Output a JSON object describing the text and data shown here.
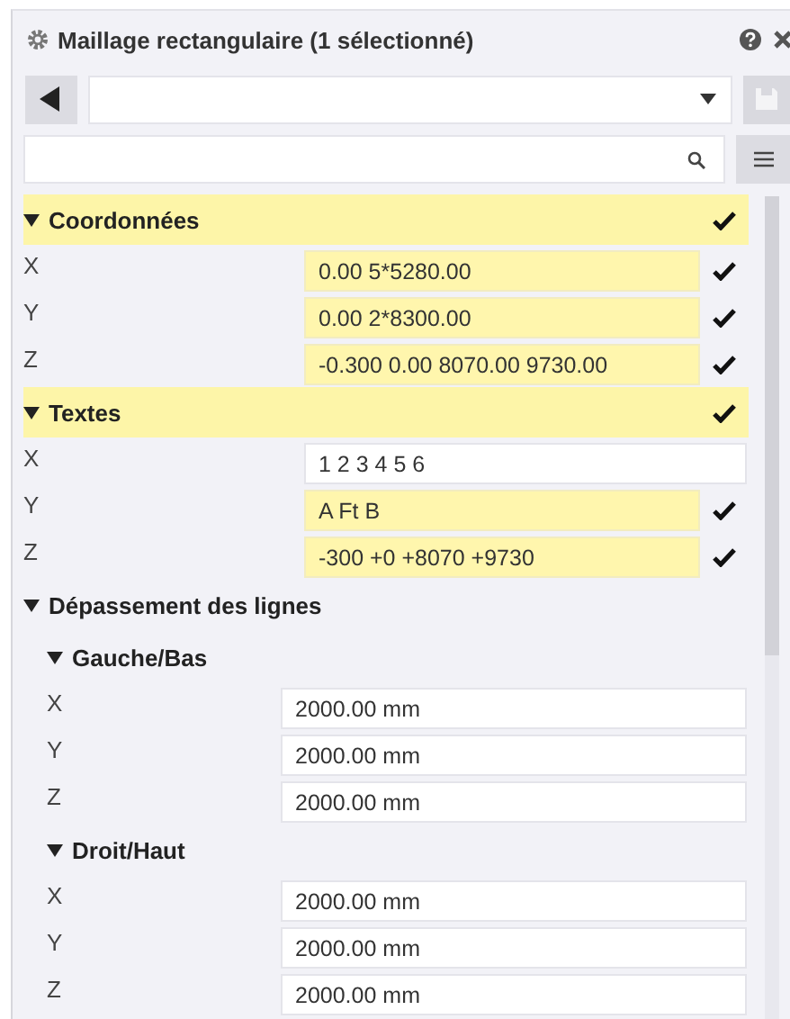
{
  "panel": {
    "title": "Maillage rectangulaire (1 sélectionné)"
  },
  "sections": [
    {
      "label": "Coordonnées",
      "expanded": true,
      "highlighted": true,
      "checked": true,
      "rows": [
        {
          "label": "X",
          "value": "0.00 5*5280.00",
          "highlighted": true,
          "checked": true
        },
        {
          "label": "Y",
          "value": "0.00 2*8300.00",
          "highlighted": true,
          "checked": true
        },
        {
          "label": "Z",
          "value": "-0.300 0.00 8070.00 9730.00",
          "highlighted": true,
          "checked": true
        }
      ]
    },
    {
      "label": "Textes",
      "expanded": true,
      "highlighted": true,
      "checked": true,
      "rows": [
        {
          "label": "X",
          "value": "1 2 3 4 5 6",
          "highlighted": false,
          "checked": false
        },
        {
          "label": "Y",
          "value": "A Ft B",
          "highlighted": true,
          "checked": true
        },
        {
          "label": "Z",
          "value": "-300 +0 +8070 +9730",
          "highlighted": true,
          "checked": true
        }
      ]
    },
    {
      "label": "Dépassement des lignes",
      "expanded": true,
      "highlighted": false,
      "checked": false,
      "children": [
        {
          "label": "Gauche/Bas",
          "expanded": true,
          "highlighted": false,
          "checked": false,
          "rows": [
            {
              "label": "X",
              "value": "2000.00 mm",
              "highlighted": false,
              "checked": false
            },
            {
              "label": "Y",
              "value": "2000.00 mm",
              "highlighted": false,
              "checked": false
            },
            {
              "label": "Z",
              "value": "2000.00 mm",
              "highlighted": false,
              "checked": false
            }
          ]
        },
        {
          "label": "Droit/Haut",
          "expanded": true,
          "highlighted": false,
          "checked": false,
          "rows": [
            {
              "label": "X",
              "value": "2000.00 mm",
              "highlighted": false,
              "checked": false
            },
            {
              "label": "Y",
              "value": "2000.00 mm",
              "highlighted": false,
              "checked": false
            },
            {
              "label": "Z",
              "value": "2000.00 mm",
              "highlighted": false,
              "checked": false
            }
          ]
        }
      ]
    }
  ]
}
